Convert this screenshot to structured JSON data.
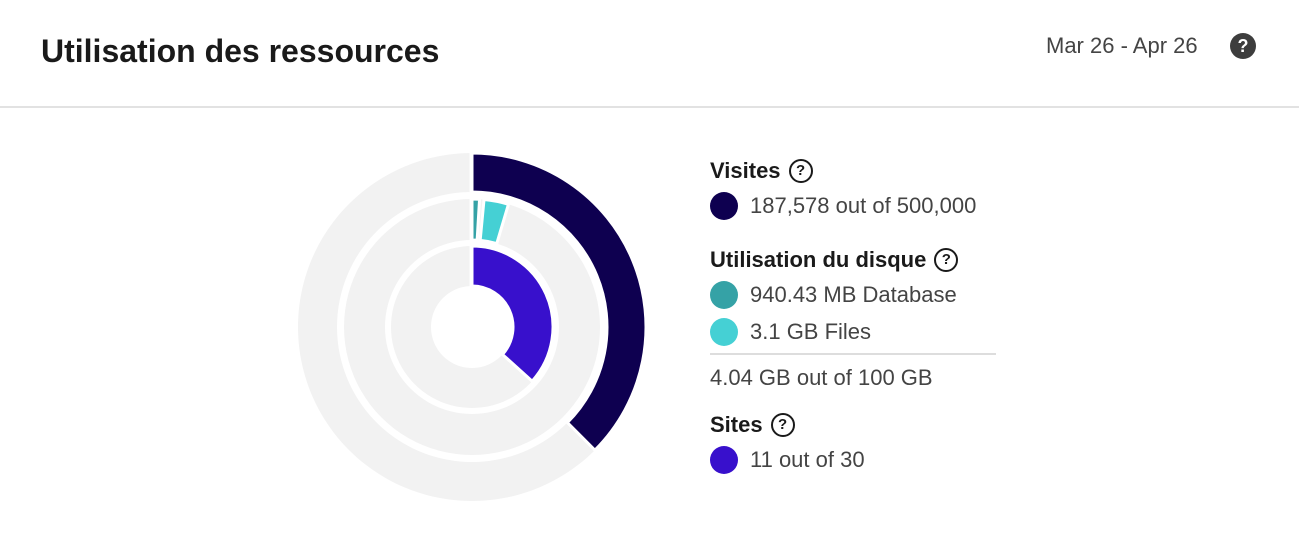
{
  "header": {
    "title": "Utilisation des ressources",
    "date_range": "Mar 26 - Apr 26",
    "help": "?"
  },
  "legend": {
    "visits": {
      "title": "Visites",
      "help": "?",
      "value": "187,578 out of 500,000",
      "color": "#0e0050"
    },
    "disk": {
      "title": "Utilisation du disque",
      "help": "?",
      "database": "940.43 MB Database",
      "database_color": "#35a2a6",
      "files": "3.1 GB Files",
      "files_color": "#45d0d4",
      "total": "4.04 GB out of 100 GB"
    },
    "sites": {
      "title": "Sites",
      "help": "?",
      "value": "11 out of 30",
      "color": "#3810cc"
    }
  },
  "chart_data": {
    "type": "radial-bar",
    "track_color": "#f2f2f2",
    "rings": [
      {
        "name": "Visites",
        "segments": [
          {
            "label": "Visits",
            "value": 187578,
            "color": "#0e0050"
          }
        ],
        "max": 500000
      },
      {
        "name": "Utilisation du disque",
        "segments": [
          {
            "label": "Database",
            "value": 0.94043,
            "color": "#35a2a6"
          },
          {
            "label": "Files",
            "value": 3.1,
            "color": "#45d0d4"
          }
        ],
        "max": 100
      },
      {
        "name": "Sites",
        "segments": [
          {
            "label": "Sites",
            "value": 11,
            "color": "#3810cc"
          }
        ],
        "max": 30
      }
    ]
  }
}
